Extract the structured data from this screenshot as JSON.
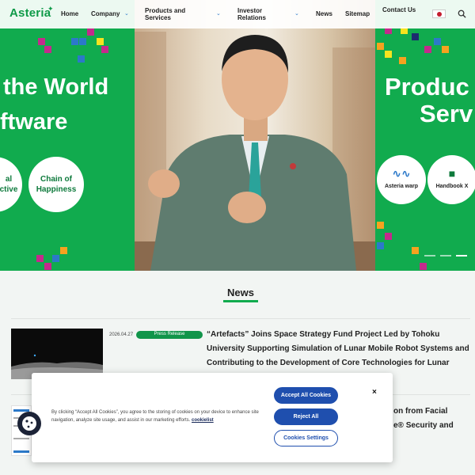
{
  "header": {
    "logo": "Asteria",
    "nav": {
      "home": "Home",
      "company": "Company",
      "products_line1": "Products and",
      "products_line2": "Services",
      "investor_line1": "Investor",
      "investor_line2": "Relations",
      "news": "News",
      "sitemap": "Sitemap",
      "contact": "Contact Us"
    },
    "icons": {
      "flag": "japan-flag-icon",
      "search": "search-icon",
      "chevron": "chevron-down-icon"
    }
  },
  "hero": {
    "left_headline_1": "the World",
    "left_headline_2": "ftware",
    "badge_left_1": "al",
    "badge_left_2": "ctive",
    "badge_right_1": "Chain of",
    "badge_right_2": "Happiness",
    "right_headline_1": "Produc",
    "right_headline_2": "Serv",
    "product_1": "Asteria warp",
    "product_2": "Handbook X"
  },
  "news": {
    "title": "News",
    "items": [
      {
        "date": "2026.04.27",
        "category": "Press Release",
        "headline_lines": [
          "“Artefacts” Joins Space Strategy Fund Project Led by Tohoku",
          "University Supporting Simulation of Lunar Mobile Robot Systems and",
          "Contributing to the Development of Core Technologies for Lunar"
        ]
      },
      {
        "headline_lines": [
          "on from Facial",
          "e® Security and"
        ]
      }
    ]
  },
  "cookie_banner": {
    "text": "By clicking “Accept All Cookies”, you agree to the storing of cookies on your device to enhance site navigation, analyze site usage, and assist in our marketing efforts.",
    "link": "cookielist",
    "accept_all": "Accept All Cookies",
    "reject_all": "Reject All",
    "settings": "Cookies Settings",
    "close": "×"
  },
  "colors": {
    "brand_green": "#11ab4e",
    "button_blue": "#1f4fae"
  }
}
